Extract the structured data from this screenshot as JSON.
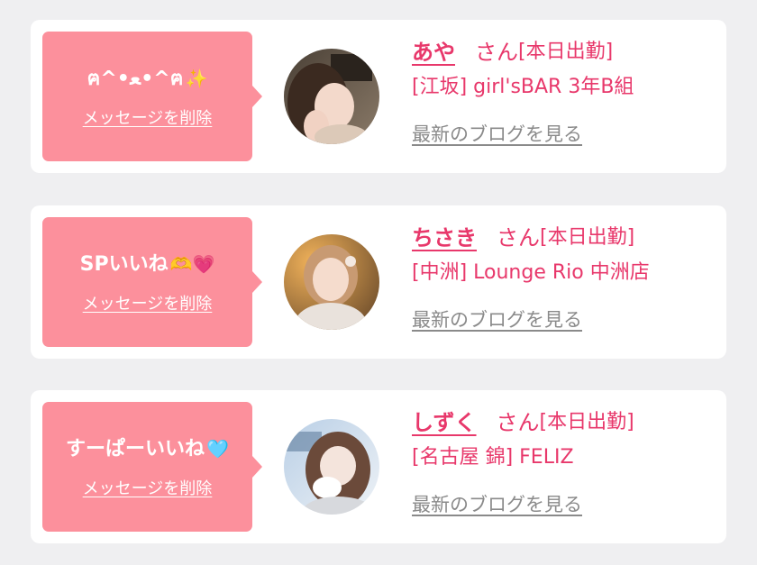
{
  "messages": [
    {
      "message_text": "ฅ^•ﻌ•^ฅ",
      "message_emoji": "✨",
      "delete_label": "メッセージを削除",
      "girl_name": "あや",
      "honorific": "さん",
      "status": "[本日出勤]",
      "shop": "[江坂] girl'sBAR 3年B組",
      "blog_label": "最新のブログを見る"
    },
    {
      "message_text": "SPいいね",
      "message_emoji": "🫶💗",
      "delete_label": "メッセージを削除",
      "girl_name": "ちさき",
      "honorific": "さん",
      "status": "[本日出勤]",
      "shop": "[中洲] Lounge Rio 中洲店",
      "blog_label": "最新のブログを見る"
    },
    {
      "message_text": "すーぱーいいね",
      "message_emoji": "🩵",
      "delete_label": "メッセージを削除",
      "girl_name": "しずく",
      "honorific": "さん",
      "status": "[本日出勤]",
      "shop": "[名古屋 錦] FELIZ",
      "blog_label": "最新のブログを見る"
    }
  ],
  "colors": {
    "page_bg": "#efeff1",
    "card_bg": "#ffffff",
    "bubble_bg": "#fc909c",
    "accent": "#e8386b",
    "link_gray": "#8a8a8a"
  }
}
